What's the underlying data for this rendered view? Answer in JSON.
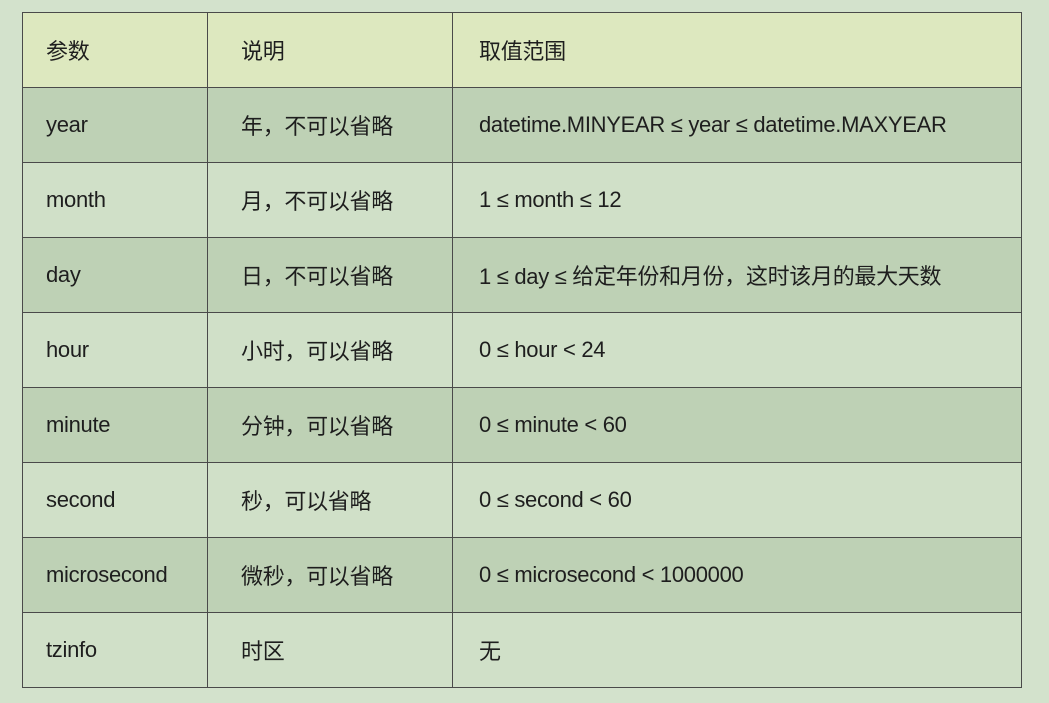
{
  "table": {
    "headers": [
      "参数",
      "说明",
      "取值范围"
    ],
    "rows": [
      {
        "param": "year",
        "desc": "年，不可以省略",
        "range": "datetime.MINYEAR ≤  year ≤  datetime.MAXYEAR"
      },
      {
        "param": "month",
        "desc": "月，不可以省略",
        "range": "1 ≤ month ≤ 12"
      },
      {
        "param": "day",
        "desc": "日，不可以省略",
        "range": "1 ≤ day ≤ 给定年份和月份，这时该月的最大天数"
      },
      {
        "param": "hour",
        "desc": "小时，可以省略",
        "range": "0 ≤ hour < 24"
      },
      {
        "param": "minute",
        "desc": "分钟，可以省略",
        "range": "0 ≤ minute < 60"
      },
      {
        "param": "second",
        "desc": "秒，可以省略",
        "range": "0 ≤ second < 60"
      },
      {
        "param": "microsecond",
        "desc": "微秒，可以省略",
        "range": "0 ≤ microsecond < 1000000"
      },
      {
        "param": "tzinfo",
        "desc": "时区",
        "range": "无"
      }
    ]
  },
  "colors": {
    "page_background": "#d3e2cc",
    "header_background": "#dde8bf",
    "row_shaded": "#bed1b5",
    "row_light": "#d0e0c8",
    "border": "#4a4a4a",
    "text": "#1e1e1e"
  }
}
